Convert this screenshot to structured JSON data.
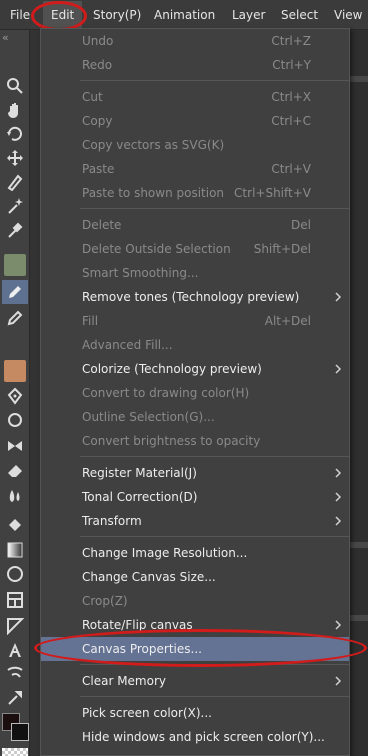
{
  "menubar": {
    "items": [
      {
        "label": "File"
      },
      {
        "label": "Edit"
      },
      {
        "label": "Story(P)"
      },
      {
        "label": "Animation"
      },
      {
        "label": "Layer"
      },
      {
        "label": "Select"
      },
      {
        "label": "View"
      }
    ],
    "active": "Edit"
  },
  "toolbar": {
    "collapse_glyph": "«",
    "tools": [
      "zoom-icon",
      "hand-icon",
      "rotate-icon",
      "move-icon",
      "operation-icon",
      "magic-wand-icon",
      "eyedropper-icon",
      "sub-tool-thumbnail",
      "pen-icon",
      "pencil-icon",
      "brush-thumbnail",
      "ink-pen-icon",
      "decoration-icon",
      "airbrush-icon",
      "eraser-icon",
      "blend-icon",
      "fill-icon",
      "gradient-icon",
      "figure-icon",
      "frame-icon",
      "ruler-icon",
      "text-icon",
      "balloon-icon",
      "correct-line-icon"
    ],
    "selected_tool": "pen-icon"
  },
  "colors": {
    "menu_bg": "#404040",
    "highlight": "#647294",
    "annotation_red": "#d21b1b",
    "enabled_text": "#ededed",
    "disabled_text": "#8a8a8a"
  },
  "edit_menu": {
    "groups": [
      [
        {
          "label": "Undo",
          "shortcut": "Ctrl+Z",
          "enabled": false
        },
        {
          "label": "Redo",
          "shortcut": "Ctrl+Y",
          "enabled": false
        }
      ],
      [
        {
          "label": "Cut",
          "shortcut": "Ctrl+X",
          "enabled": false
        },
        {
          "label": "Copy",
          "shortcut": "Ctrl+C",
          "enabled": false
        },
        {
          "label": "Copy vectors as SVG(K)",
          "shortcut": "",
          "enabled": false
        },
        {
          "label": "Paste",
          "shortcut": "Ctrl+V",
          "enabled": false
        },
        {
          "label": "Paste to shown position",
          "shortcut": "Ctrl+Shift+V",
          "enabled": false
        }
      ],
      [
        {
          "label": "Delete",
          "shortcut": "Del",
          "enabled": false
        },
        {
          "label": "Delete Outside Selection",
          "shortcut": "Shift+Del",
          "enabled": false
        },
        {
          "label": "Smart Smoothing...",
          "shortcut": "",
          "enabled": false
        },
        {
          "label": "Remove tones (Technology preview)",
          "shortcut": "",
          "enabled": true,
          "submenu": true
        },
        {
          "label": "Fill",
          "shortcut": "Alt+Del",
          "enabled": false
        },
        {
          "label": "Advanced Fill...",
          "shortcut": "",
          "enabled": false
        },
        {
          "label": "Colorize (Technology preview)",
          "shortcut": "",
          "enabled": true,
          "submenu": true
        },
        {
          "label": "Convert to drawing color(H)",
          "shortcut": "",
          "enabled": false
        },
        {
          "label": "Outline Selection(G)...",
          "shortcut": "",
          "enabled": false
        },
        {
          "label": "Convert brightness to opacity",
          "shortcut": "",
          "enabled": false
        }
      ],
      [
        {
          "label": "Register Material(J)",
          "shortcut": "",
          "enabled": true,
          "submenu": true
        },
        {
          "label": "Tonal Correction(D)",
          "shortcut": "",
          "enabled": true,
          "submenu": true
        },
        {
          "label": "Transform",
          "shortcut": "",
          "enabled": true,
          "submenu": true
        }
      ],
      [
        {
          "label": "Change Image Resolution...",
          "shortcut": "",
          "enabled": true
        },
        {
          "label": "Change Canvas Size...",
          "shortcut": "",
          "enabled": true
        },
        {
          "label": "Crop(Z)",
          "shortcut": "",
          "enabled": false
        },
        {
          "label": "Rotate/Flip canvas",
          "shortcut": "",
          "enabled": true,
          "submenu": true
        },
        {
          "label": "Canvas Properties...",
          "shortcut": "",
          "enabled": true,
          "highlighted": true
        }
      ],
      [
        {
          "label": "Clear Memory",
          "shortcut": "",
          "enabled": true,
          "submenu": true
        }
      ],
      [
        {
          "label": "Pick screen color(X)...",
          "shortcut": "",
          "enabled": true
        },
        {
          "label": "Hide windows and pick screen color(Y)...",
          "shortcut": "",
          "enabled": true
        }
      ]
    ]
  }
}
